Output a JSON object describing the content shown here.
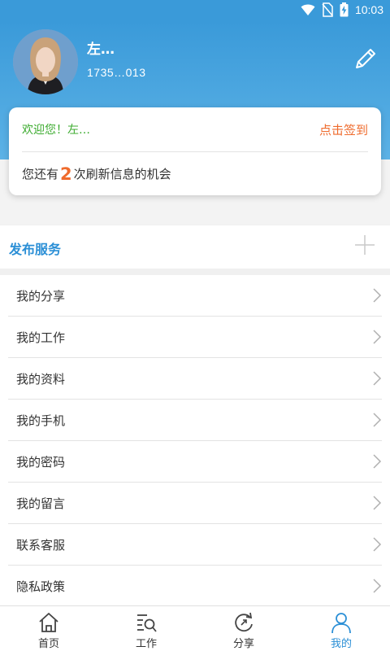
{
  "status_bar": {
    "time": "10:03"
  },
  "profile": {
    "name": "左…",
    "phone": "1735…013",
    "edit_icon": "pencil-icon"
  },
  "welcome_card": {
    "greeting": "欢迎您！左…",
    "signin_label": "点击签到",
    "refresh_prefix": "您还有",
    "refresh_count": "2",
    "refresh_suffix": "次刷新信息的机会"
  },
  "publish": {
    "label": "发布服务",
    "icon": "plus-icon"
  },
  "menu": {
    "items": [
      {
        "label": "我的分享"
      },
      {
        "label": "我的工作"
      },
      {
        "label": "我的资料"
      },
      {
        "label": "我的手机"
      },
      {
        "label": "我的密码"
      },
      {
        "label": "我的留言"
      },
      {
        "label": "联系客服"
      },
      {
        "label": "隐私政策"
      }
    ]
  },
  "tabbar": {
    "tabs": [
      {
        "label": "首页",
        "icon": "home-icon"
      },
      {
        "label": "工作",
        "icon": "job-search-icon"
      },
      {
        "label": "分享",
        "icon": "share-refresh-icon"
      },
      {
        "label": "我的",
        "icon": "user-icon",
        "active": true
      }
    ]
  },
  "colors": {
    "header_blue": "#3a9ad9",
    "accent_blue": "#2b8fd6",
    "accent_orange": "#ef6b2d",
    "welcome_green": "#3cab2f"
  }
}
